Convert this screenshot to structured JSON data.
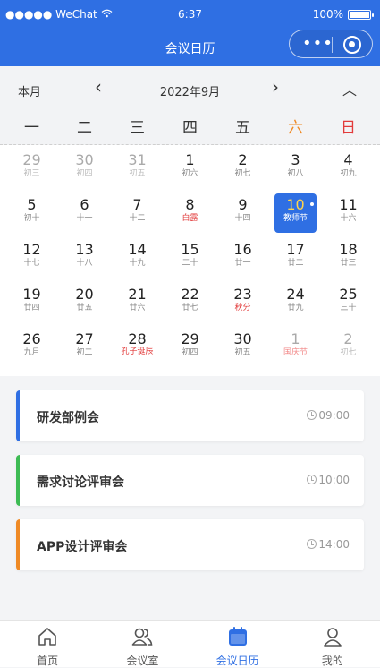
{
  "status_bar": {
    "carrier": "●●●●● WeChat",
    "time": "6:37",
    "battery": "100%"
  },
  "header": {
    "title": "会议日历",
    "menu": "•••"
  },
  "calendar": {
    "mode": "本月",
    "prev": "‹",
    "month_label": "2022年9月",
    "next": "›",
    "collapse": "︿",
    "weekdays": [
      "一",
      "二",
      "三",
      "四",
      "五",
      "六",
      "日"
    ],
    "weeks": [
      [
        {
          "day": "29",
          "sub": "初三",
          "muted": true
        },
        {
          "day": "30",
          "sub": "初四",
          "muted": true
        },
        {
          "day": "31",
          "sub": "初五",
          "muted": true
        },
        {
          "day": "1",
          "sub": "初六"
        },
        {
          "day": "2",
          "sub": "初七"
        },
        {
          "day": "3",
          "sub": "初八"
        },
        {
          "day": "4",
          "sub": "初九"
        }
      ],
      [
        {
          "day": "5",
          "sub": "初十"
        },
        {
          "day": "6",
          "sub": "十一"
        },
        {
          "day": "7",
          "sub": "十二"
        },
        {
          "day": "8",
          "sub": "白露",
          "red": true
        },
        {
          "day": "9",
          "sub": "十四"
        },
        {
          "day": "10",
          "sub": "教师节",
          "today": true
        },
        {
          "day": "11",
          "sub": "十六"
        }
      ],
      [
        {
          "day": "12",
          "sub": "十七"
        },
        {
          "day": "13",
          "sub": "十八"
        },
        {
          "day": "14",
          "sub": "十九"
        },
        {
          "day": "15",
          "sub": "二十"
        },
        {
          "day": "16",
          "sub": "廿一"
        },
        {
          "day": "17",
          "sub": "廿二"
        },
        {
          "day": "18",
          "sub": "廿三"
        }
      ],
      [
        {
          "day": "19",
          "sub": "廿四"
        },
        {
          "day": "20",
          "sub": "廿五"
        },
        {
          "day": "21",
          "sub": "廿六"
        },
        {
          "day": "22",
          "sub": "廿七"
        },
        {
          "day": "23",
          "sub": "秋分",
          "red": true
        },
        {
          "day": "24",
          "sub": "廿九"
        },
        {
          "day": "25",
          "sub": "三十"
        }
      ],
      [
        {
          "day": "26",
          "sub": "九月"
        },
        {
          "day": "27",
          "sub": "初二"
        },
        {
          "day": "28",
          "sub": "孔子诞辰",
          "red": true
        },
        {
          "day": "29",
          "sub": "初四"
        },
        {
          "day": "30",
          "sub": "初五"
        },
        {
          "day": "1",
          "sub": "国庆节",
          "muted": true,
          "red": true
        },
        {
          "day": "2",
          "sub": "初七",
          "muted": true
        }
      ]
    ]
  },
  "meetings": [
    {
      "name": "研发部例会",
      "time": "09:00",
      "color": "#2f6fe3"
    },
    {
      "name": "需求讨论评审会",
      "time": "10:00",
      "color": "#3dbb54"
    },
    {
      "name": "APP设计评审会",
      "time": "14:00",
      "color": "#ef8a25"
    }
  ],
  "tabs": [
    {
      "label": "首页",
      "icon": "home-icon"
    },
    {
      "label": "会议室",
      "icon": "users-icon"
    },
    {
      "label": "会议日历",
      "icon": "calendar-icon",
      "active": true
    },
    {
      "label": "我的",
      "icon": "user-icon"
    }
  ],
  "colors": {
    "primary": "#2f6fe3",
    "saturday": "#ef8a25",
    "sunday": "#e23b3b",
    "today_number": "#ffd34a"
  }
}
